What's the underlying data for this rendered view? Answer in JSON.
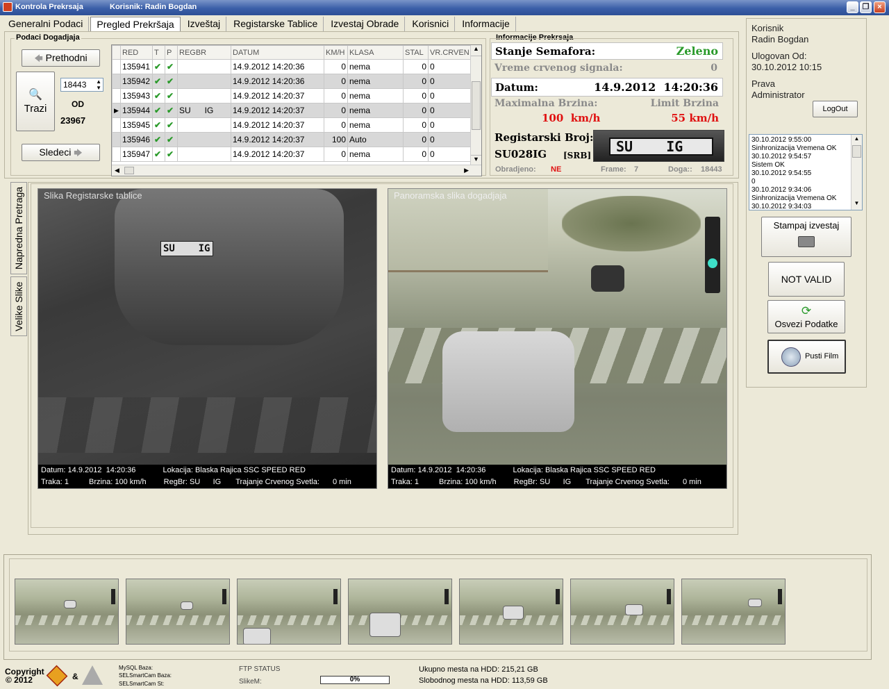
{
  "window": {
    "title": "Kontrola Prekrsaja",
    "user_title": "Korisnik: Radin Bogdan"
  },
  "tabs": [
    "Generalni Podaci",
    "Pregled Prekršaja",
    "Izveštaj",
    "Registarske Tablice",
    "Izvestaj Obrade",
    "Korisnici",
    "Informacije"
  ],
  "events": {
    "group_title": "Podaci Dogadjaja",
    "prev_label": "Prethodni",
    "next_label": "Sledeci",
    "search_label": "Trazi",
    "current_value": "18443",
    "of_label": "OD",
    "total": "23967",
    "columns": [
      "RED",
      "T",
      "P",
      "REGBR",
      "DATUM",
      "KM/H",
      "KLASA",
      "STAL",
      "VR.CRVEN"
    ],
    "rows": [
      {
        "red": "135941",
        "regbr": "",
        "datum": "14.9.2012 14:20:36",
        "kmh": "0",
        "klasa": "nema",
        "stal": "0",
        "vr": "0"
      },
      {
        "red": "135942",
        "regbr": "",
        "datum": "14.9.2012 14:20:36",
        "kmh": "0",
        "klasa": "nema",
        "stal": "0",
        "vr": "0"
      },
      {
        "red": "135943",
        "regbr": "",
        "datum": "14.9.2012 14:20:37",
        "kmh": "0",
        "klasa": "nema",
        "stal": "0",
        "vr": "0"
      },
      {
        "red": "135944",
        "regbr": "SU      IG",
        "datum": "14.9.2012 14:20:37",
        "kmh": "0",
        "klasa": "nema",
        "stal": "0",
        "vr": "0"
      },
      {
        "red": "135945",
        "regbr": "",
        "datum": "14.9.2012 14:20:37",
        "kmh": "0",
        "klasa": "nema",
        "stal": "0",
        "vr": "0"
      },
      {
        "red": "135946",
        "regbr": "",
        "datum": "14.9.2012 14:20:37",
        "kmh": "100",
        "klasa": "Auto",
        "stal": "0",
        "vr": "0"
      },
      {
        "red": "135947",
        "regbr": "",
        "datum": "14.9.2012 14:20:37",
        "kmh": "0",
        "klasa": "nema",
        "stal": "0",
        "vr": "0"
      }
    ]
  },
  "info": {
    "group_title": "Informacije Prekrsaja",
    "semafor_label": "Stanje Semafora:",
    "semafor_value": "Zeleno",
    "red_time_label": "Vreme crvenog signala:",
    "red_time_value": "0",
    "date_label": "Datum:",
    "date_value": "14.9.2012  14:20:36",
    "max_speed_label": "Maximalna Brzina:",
    "max_speed_value": "100  km/h",
    "limit_label": "Limit Brzina",
    "limit_value": "55 km/h",
    "reg_label": "Registarski Broj:",
    "reg_value": "SU028IG",
    "reg_country": "[SRB]",
    "plate_text": "SU    IG",
    "processed_label": "Obradjeno:",
    "processed_value": "NE",
    "frame_label": "Frame:",
    "frame_value": "7",
    "doga_label": "Doga::",
    "doga_value": "18443"
  },
  "user": {
    "user_label": "Korisnik",
    "user_name": "Radin Bogdan",
    "logged_label": "Ulogovan Od:",
    "logged_value": "30.10.2012 10:15",
    "rights_label": "Prava",
    "rights_value": "Administrator",
    "logout_label": "LogOut"
  },
  "log": [
    "30.10.2012 9:55:00",
    "Sinhronizacija Vremena OK",
    "30.10.2012 9:54:57",
    "Sistem OK",
    "30.10.2012 9:54:55",
    "0",
    "30.10.2012 9:34:06",
    "Sinhronizacija Vremena OK",
    "30.10.2012 9:34:03"
  ],
  "actions": {
    "print_label": "Stampaj izvestaj",
    "not_valid_label": "NOT VALID",
    "refresh_label": "Osvezi Podatke",
    "film_label": "Pusti Film"
  },
  "side_tabs": [
    "Napredna Pretraga",
    "Velike Slike"
  ],
  "images": {
    "plate_title": "Slika Registarske tablice",
    "pano_title": "Panoramska slika dogadjaja",
    "plate_on_car": "SU    IG",
    "cap": {
      "date_label": "Datum:",
      "date": "14.9.2012  14:20:36",
      "loc_label": "Lokacija:",
      "loc": "Blaska Rajica SSC SPEED RED",
      "lane_label": "Traka:",
      "lane": "1",
      "speed_label": "Brzina:",
      "speed": "100 km/h",
      "reg_label": "RegBr:",
      "reg": "SU      IG",
      "red_label": "Trajanje Crvenog Svetla:",
      "red": "0 min"
    }
  },
  "status": {
    "copyright": "Copyright",
    "copy_year": "© 2012",
    "amp": "&",
    "mysql": "MySQL Baza:",
    "sel": "SELSmartCam Baza:",
    "sel_st": "SELSmartCam St:",
    "ftp": "FTP STATUS",
    "slike": "SlikeM:",
    "progress": "0%",
    "hdd_total": "Ukupno mesta na HDD: 215,21 GB",
    "hdd_free": "Slobodnog mesta na HDD: 113,59 GB"
  }
}
